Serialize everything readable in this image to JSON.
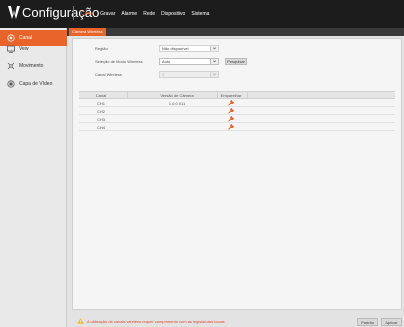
{
  "app": {
    "title": "Configuração"
  },
  "nav": [
    {
      "label": "Canal",
      "active": true
    },
    {
      "label": "Gravar",
      "active": false
    },
    {
      "label": "Alarme",
      "active": false
    },
    {
      "label": "Rede",
      "active": false
    },
    {
      "label": "Dispositivo",
      "active": false
    },
    {
      "label": "Sistema",
      "active": false
    }
  ],
  "sidebar": [
    {
      "label": "Canal",
      "icon": "camera-icon",
      "active": true
    },
    {
      "label": "Vew",
      "icon": "monitor-icon",
      "active": false
    },
    {
      "label": "Movimento",
      "icon": "motion-icon",
      "active": false
    },
    {
      "label": "Capa de Vídeo",
      "icon": "video-cover-icon",
      "active": false
    }
  ],
  "subtab": {
    "label": "Câmera Wireless"
  },
  "form": {
    "region_label": "Região",
    "region_value": "Não disponível",
    "channel_select_label": "Seleção de Modo Wireless",
    "channel_select_value": "Auto",
    "search_button": "Pesquisar",
    "wireless_channel_label": "Canal Wireless",
    "wireless_channel_value": "1"
  },
  "table": {
    "headers": [
      "Canal",
      "Versão de Câmera",
      "Emparelhar"
    ],
    "rows": [
      {
        "channel": "CH1",
        "version": "1.0.0.011"
      },
      {
        "channel": "CH2",
        "version": ""
      },
      {
        "channel": "CH3",
        "version": ""
      },
      {
        "channel": "CH4",
        "version": ""
      }
    ]
  },
  "footer": {
    "warning": "A utilização de canais wireless requer cumprimento com as legislaturas locais.",
    "default_button": "Padrão",
    "apply_button": "Aplicar"
  },
  "colors": {
    "accent": "#e8642a",
    "header": "#1c1c1c",
    "warning": "#d94b2b"
  }
}
